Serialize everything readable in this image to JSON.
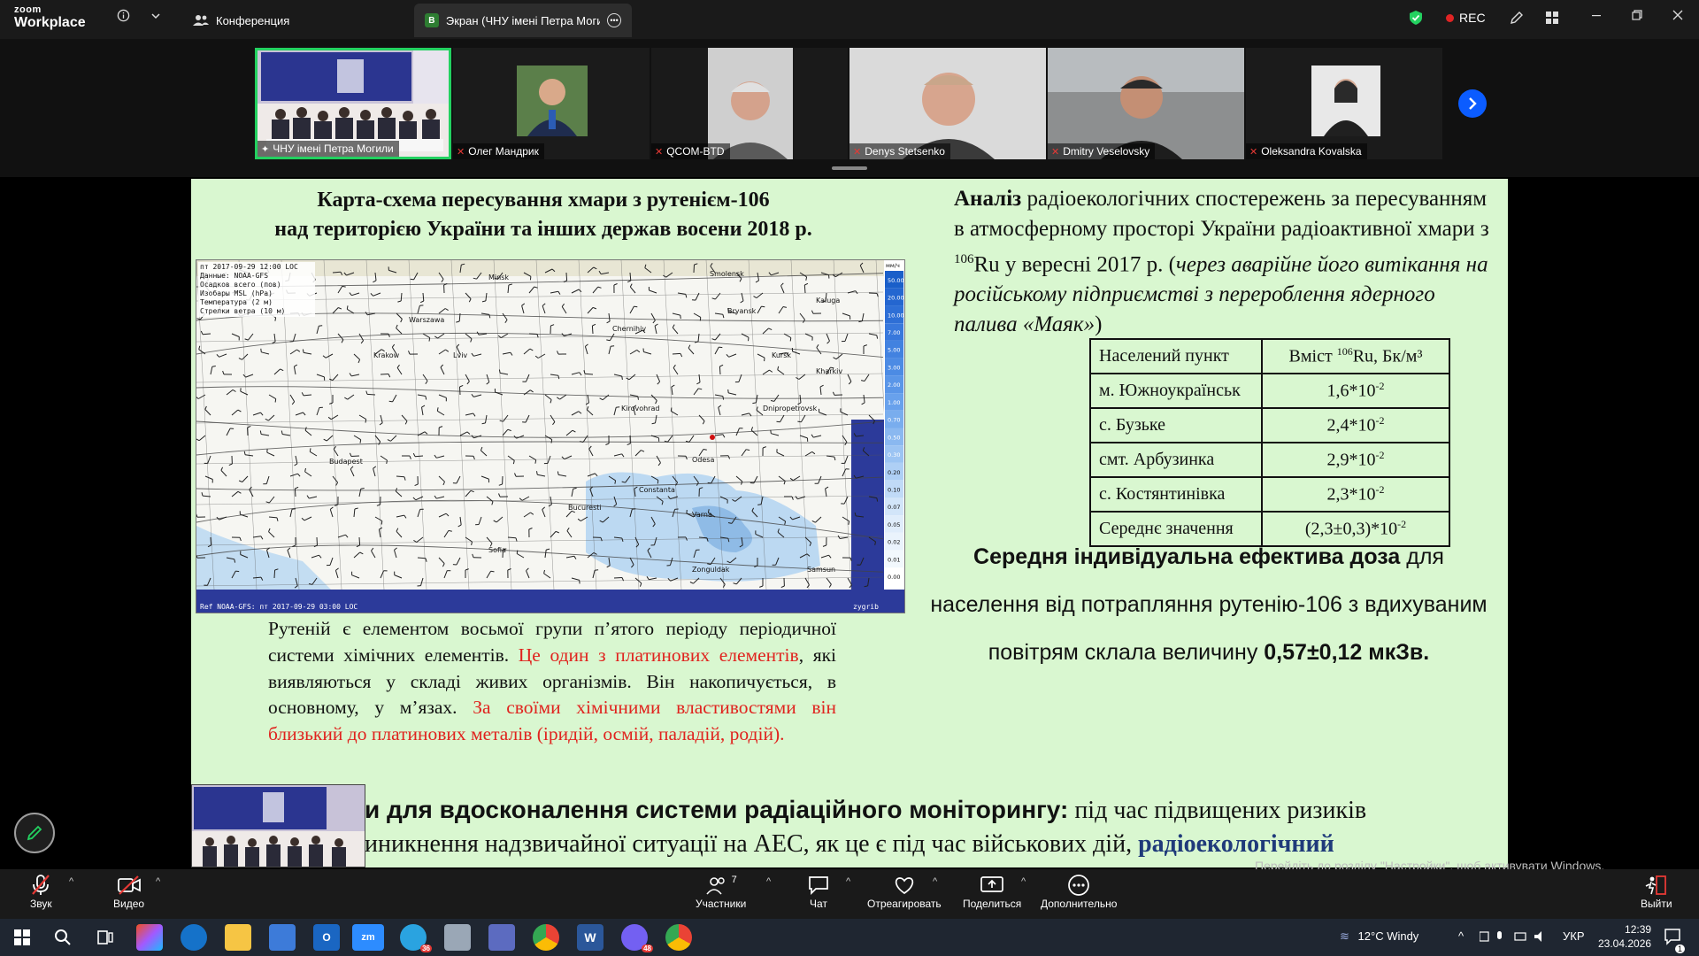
{
  "zoom": {
    "logo_top": "zoom",
    "logo_bottom": "Workplace",
    "tabs": [
      {
        "label": "Конференция"
      },
      {
        "badge": "B",
        "label": "Экран (ЧНУ імені Петра Могили"
      }
    ],
    "rec_label": "REC"
  },
  "participants": [
    {
      "name": "ЧНУ імені Петра Могили"
    },
    {
      "name": "Олег Мандрик"
    },
    {
      "name": "QCOM-BTD"
    },
    {
      "name": "Denys Stetsenko"
    },
    {
      "name": "Dmitry Veselovsky"
    },
    {
      "name": "Oleksandra Kovalska"
    }
  ],
  "slide": {
    "map_title_1": "Карта-схема пересування хмари з рутенієм-106",
    "map_title_2": "над територією України та інших держав восени 2018 р.",
    "map_header_1": "пт 2017-09-29 12:00 LOC",
    "map_header_2": "Данные: NOAA-GFS",
    "map_header_3": "Осадков всего (пов)",
    "map_header_4": "Изобары MSL (hPa)",
    "map_header_5": "Температура (2 м)",
    "map_header_6": "Стрелки ветра (10 м)",
    "map_footer": "Ref NOAA-GFS: пт 2017-09-29 03:00 LOC",
    "map_corner_right": "zygrib",
    "map_scale_unit": "мм/ч",
    "map_scale": [
      "50.00",
      "20.00",
      "10.00",
      "7.00",
      "5.00",
      "3.00",
      "2.00",
      "1.00",
      "0.70",
      "0.50",
      "0.30",
      "0.20",
      "0.10",
      "0.07",
      "0.05",
      "0.02",
      "0.01",
      "0.00"
    ],
    "map_cities": [
      "Minsk",
      "Smolensk",
      "Kaluga",
      "Bryansk",
      "Kursk",
      "Kharkiv",
      "Dnipropetrovsk",
      "Odesa",
      "Bucuresti",
      "Warszawa",
      "Krakow",
      "Budapest",
      "Lviv",
      "Chernihiv",
      "Kirovohrad",
      "Constanta",
      "Varna",
      "Samsun",
      "Zonguldak",
      "Sofia"
    ],
    "analysis_bold": "Аналіз",
    "analysis_1": " радіоекологічних спостережень за пересуванням  в атмосферному просторі України радіоактивної хмари з ",
    "analysis_sup": "106",
    "analysis_2": "Ru  у вересні 2017 р. (",
    "analysis_italic": "через аварійне його витікання на російському підприємстві з перероблення ядерного палива «Маяк»",
    "analysis_3": ")",
    "table": {
      "h1": "Населений пункт",
      "h2_pre": "Вміст ",
      "h2_sup": "106",
      "h2_post": "Ru, Бк/м³",
      "rows": [
        {
          "place": "м. Южноукраїнськ",
          "base": "1,6*10",
          "exp": "-2"
        },
        {
          "place": "с. Бузьке",
          "base": "2,4*10",
          "exp": "-2"
        },
        {
          "place": "смт. Арбузинка",
          "base": "2,9*10",
          "exp": "-2"
        },
        {
          "place": "с. Костянтинівка",
          "base": "2,3*10",
          "exp": "-2"
        },
        {
          "place": "Середнє значення",
          "base": "(2,3±0,3)*10",
          "exp": "-2"
        }
      ]
    },
    "dose_bold": "Середня індивідуальна ефектива доза",
    "dose_1": " для населення від потрапляння рутенію-106 з вдихуваним повітрям склала величину ",
    "dose_value": "0,57±0,12  мкЗв.",
    "ru_1": "Рутеній є елементом восьмої групи п’ятого періоду періодичної системи хімічних елементів. ",
    "ru_red_1": "Це один з платинових елементів",
    "ru_2": ", які виявляються у складі живих організмів. Він накопичується, в основному, у м’язах. ",
    "ru_red_2": "За своїми хімічними властивостями він близький до платинових металів (іридій, осмій, паладій, родій).",
    "bottom_bold": "и для вдосконалення системи радіаційного моніторингу:",
    "bottom_1": " під час підвищених ризиків",
    "bottom_2": "иникнення надзвичайної ситуації на АЕС, як це є під час військових дій, ",
    "bottom_navy": "радіоекологічний"
  },
  "activate_windows": "Перейдіть до розділу \"Настройки\", щоб активувати Windows.",
  "controls": {
    "audio": "Звук",
    "video": "Видео",
    "participants": "Участники",
    "participants_count": "7",
    "chat": "Чат",
    "react": "Отреагировать",
    "share": "Поделиться",
    "more": "Дополнительно",
    "leave": "Выйти"
  },
  "taskbar": {
    "zoom_label": "zm",
    "telegram_badge": "36",
    "viber_badge": "48",
    "weather": "12°C  Windy",
    "lang": "УКР",
    "time": "12:39",
    "date": "23.04.2026",
    "notif_count": "1"
  },
  "colors": {
    "slide_bg": "#d9f7d0",
    "active_border": "#23d160",
    "accent_blue": "#0b5cff",
    "rec_red": "#e02424",
    "text_red": "#e0231e"
  }
}
